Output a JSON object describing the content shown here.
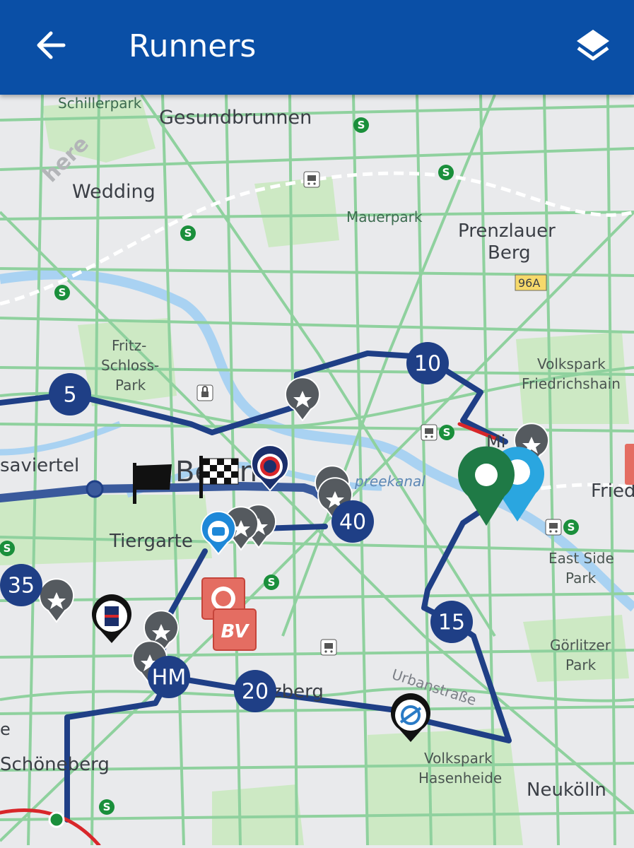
{
  "header": {
    "title": "Runners",
    "back_icon": "arrow-left-icon",
    "layers_icon": "layers-icon",
    "background": "#0a4fa6"
  },
  "map": {
    "watermark": "here",
    "colors": {
      "route": "#1f3f86",
      "route_light": "#3a5a9c",
      "streets": "#8fd19e",
      "water": "#a9d2f2",
      "parks": "#cde9c4",
      "land": "#e9eaec"
    },
    "places": {
      "schillerpark": "Schillerpark",
      "gesundbrunnen": "Gesundbrunnen",
      "wedding": "Wedding",
      "mauerpark": "Mauerpark",
      "prenzlauer": "Prenzlauer",
      "berg": "Berg",
      "road_96a": "96A",
      "fritz1": "Fritz-",
      "fritz2": "Schloss-",
      "fritz3": "Park",
      "volkspark_fh1": "Volkspark",
      "volkspark_fh2": "Friedrichshain",
      "saviertel": "saviertel",
      "spreekanal": "preekanal",
      "tiergarten": "Tiergarte",
      "east_side1": "East Side",
      "east_side2": "Park",
      "goerlitzer1": "Görlitzer",
      "goerlitzer2": "Park",
      "kreuzberg": "zberg",
      "urbanstrasse": "Urbanstraße",
      "volkspark_hh1": "Volkspark",
      "volkspark_hh2": "Hasenheide",
      "schoeneberg": "Schöneberg",
      "neukoelln": "Neukölln",
      "berlin": "Berlin",
      "mitte": "Mi",
      "friedrichshain": "Fried",
      "edge_e": "e"
    },
    "km_markers": [
      "5",
      "10",
      "15",
      "20",
      "35",
      "40",
      "HM"
    ],
    "poi_icons": [
      "star-pin-icon",
      "start-flag-icon",
      "finish-flag-icon",
      "sponsor-logo-icon",
      "s-bahn-icon",
      "train-station-icon",
      "green-location-pin-icon",
      "blue-location-pin-icon",
      "bv-sign-icon"
    ],
    "bv_label": "BV"
  }
}
